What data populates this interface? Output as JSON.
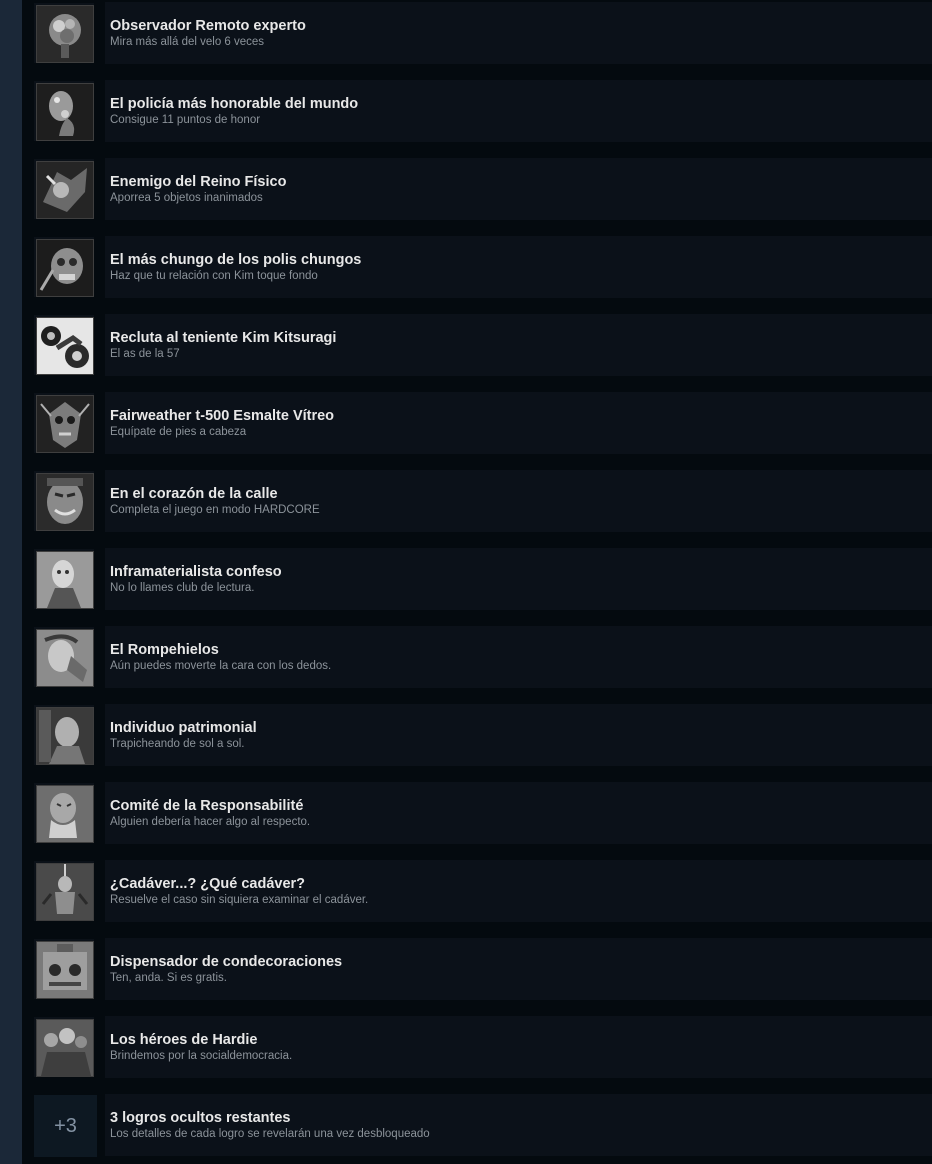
{
  "achievements": [
    {
      "title": "Observador Remoto experto",
      "desc": "Mira más allá del velo 6 veces",
      "icon": "brain-explosion-icon"
    },
    {
      "title": "El policía más honorable del mundo",
      "desc": "Consigue 11 puntos de honor",
      "icon": "thinking-man-icon"
    },
    {
      "title": "Enemigo del Reino Físico",
      "desc": "Aporrea 5 objetos inanimados",
      "icon": "fist-punch-icon"
    },
    {
      "title": "El más chungo de los polis chungos",
      "desc": "Haz que tu relación con Kim toque fondo",
      "icon": "skull-face-icon"
    },
    {
      "title": "Recluta al teniente Kim Kitsuragi",
      "desc": "El as de la 57",
      "icon": "motor-carriage-icon"
    },
    {
      "title": "Fairweather t-500 Esmalte Vítreo",
      "desc": "Equípate de pies a cabeza",
      "icon": "armored-skull-icon"
    },
    {
      "title": "En el corazón de la calle",
      "desc": "Completa el juego en modo HARDCORE",
      "icon": "grinning-man-icon"
    },
    {
      "title": "Inframaterialista confeso",
      "desc": "No lo llames club de lectura.",
      "icon": "reading-man-icon"
    },
    {
      "title": "El Rompehielos",
      "desc": "Aún puedes moverte la cara con los dedos.",
      "icon": "face-touch-icon"
    },
    {
      "title": "Individuo patrimonial",
      "desc": "Trapicheando de sol a sol.",
      "icon": "street-man-icon"
    },
    {
      "title": "Comité de la Responsabilité",
      "desc": "Alguien debería hacer algo al respecto.",
      "icon": "old-man-icon"
    },
    {
      "title": "¿Cadáver...? ¿Qué cadáver?",
      "desc": "Resuelve el caso sin siquiera examinar el cadáver.",
      "icon": "hanged-body-icon"
    },
    {
      "title": "Dispensador de condecoraciones",
      "desc": "Ten, anda. Si es gratis.",
      "icon": "machine-icon"
    },
    {
      "title": "Los héroes de Hardie",
      "desc": "Brindemos por la socialdemocracia.",
      "icon": "crowd-icon"
    }
  ],
  "hidden": {
    "count": "+3",
    "title": "3 logros ocultos restantes",
    "desc": "Los detalles de cada logro se revelarán una vez desbloqueado"
  }
}
